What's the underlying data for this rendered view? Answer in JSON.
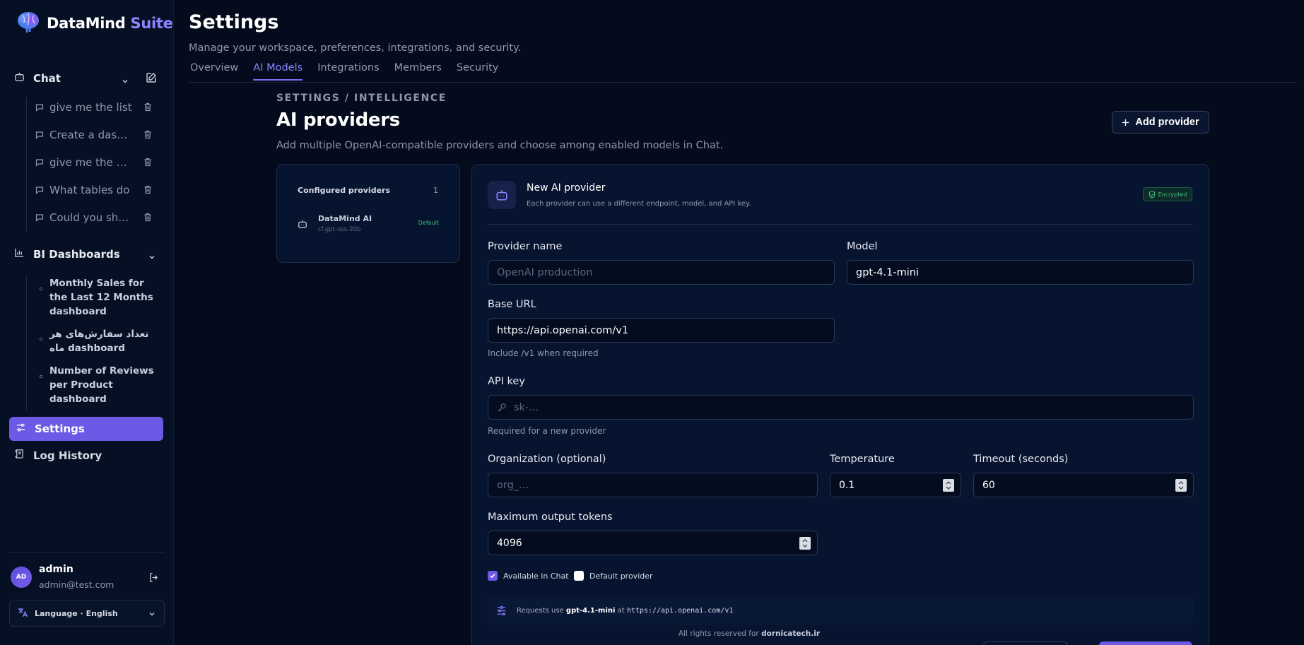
{
  "app": {
    "name_part1": "DataMind",
    "name_part2": "Suite"
  },
  "sidebar": {
    "chat_label": "Chat",
    "chat_threads": [
      {
        "label": "give me the list"
      },
      {
        "label": "Create a dashboard"
      },
      {
        "label": "give me the number"
      },
      {
        "label": "What tables do"
      },
      {
        "label": "Could you show"
      }
    ],
    "bi_label": "BI Dashboards",
    "dashboards": [
      {
        "label": "Monthly Sales for the Last 12 Months dashboard"
      },
      {
        "label": "تعداد سفارش‌های هر ماه dashboard"
      },
      {
        "label": "Number of Reviews per Product dashboard"
      }
    ],
    "settings_label": "Settings",
    "log_label": "Log History",
    "user": {
      "initials": "AD",
      "name": "admin",
      "email": "admin@test.com"
    },
    "language": "Language · English"
  },
  "header": {
    "title": "Settings",
    "subtitle": "Manage your workspace, preferences, integrations, and security.",
    "tabs": [
      {
        "label": "Overview"
      },
      {
        "label": "AI Models"
      },
      {
        "label": "Integrations"
      },
      {
        "label": "Members"
      },
      {
        "label": "Security"
      }
    ],
    "active_tab": "AI Models"
  },
  "section": {
    "breadcrumb": "SETTINGS / INTELLIGENCE",
    "title": "AI providers",
    "description": "Add multiple OpenAI-compatible providers and choose among enabled models in Chat.",
    "add_button": "Add provider"
  },
  "providers_list": {
    "title": "Configured providers",
    "count": "1",
    "items": [
      {
        "name": "DataMind AI",
        "model": "cf.gpt-oss-20b",
        "tag": "Default"
      }
    ]
  },
  "form": {
    "title": "New AI provider",
    "subtitle": "Each provider can use a different endpoint, model, and API key.",
    "badge": "Encrypted",
    "provider_name": {
      "label": "Provider name",
      "placeholder": "OpenAI production",
      "value": ""
    },
    "model": {
      "label": "Model",
      "value": "gpt-4.1-mini"
    },
    "base_url": {
      "label": "Base URL",
      "value": "https://api.openai.com/v1",
      "hint": "Include /v1 when required"
    },
    "api_key": {
      "label": "API key",
      "placeholder": "sk-...",
      "hint": "Required for a new provider"
    },
    "organization": {
      "label": "Organization (optional)",
      "placeholder": "org_..."
    },
    "temperature": {
      "label": "Temperature",
      "value": "0.1"
    },
    "timeout": {
      "label": "Timeout (seconds)",
      "value": "60"
    },
    "max_tokens": {
      "label": "Maximum output tokens",
      "value": "4096"
    },
    "available_in_chat": {
      "label": "Available in Chat",
      "checked": true
    },
    "default_provider": {
      "label": "Default provider",
      "checked": false
    },
    "summary": {
      "prefix": "Requests use",
      "model": "gpt-4.1-mini",
      "mid": "at",
      "url": "https://api.openai.com/v1"
    }
  },
  "footer": {
    "text": "All rights reserved for",
    "brand": "dornicatech.ir"
  },
  "colors": {
    "accent": "#6c5ae6",
    "background": "#040b1c",
    "success": "#3fbf7f"
  }
}
